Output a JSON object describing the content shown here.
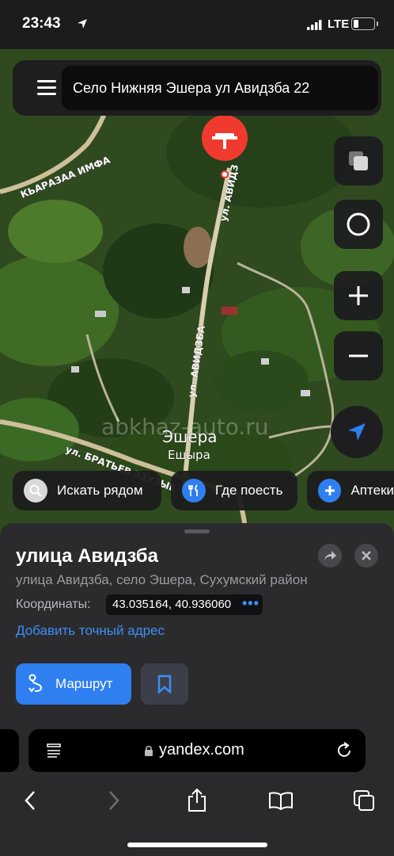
{
  "status_bar": {
    "time": "23:43",
    "network": "LTE"
  },
  "search": {
    "query": "Село Нижняя Эшера ул Авидзба 22"
  },
  "map": {
    "street_labels": [
      "КЬАРАЗАА ИМФА",
      "ул. АВИДЗ",
      "ул. АВИДЗБА",
      "ул. БРАТЬЕВ ЭЗУЗЫЕ"
    ],
    "place_name": "Эшера",
    "place_name_alt": "Ешыра",
    "watermark": "abkhaz-auto.ru"
  },
  "chips": [
    {
      "label": "Искать рядом",
      "icon": "search-icon",
      "color": "#d9d9d9"
    },
    {
      "label": "Где поесть",
      "icon": "fork-knife-icon",
      "color": "#2f7ff0"
    },
    {
      "label": "Аптеки",
      "icon": "plus-icon",
      "color": "#2f7ff0"
    }
  ],
  "card": {
    "title": "улица Авидзба",
    "subtitle": "улица Авидзба, село Эшера, Сухумский район",
    "coords_label": "Координаты:",
    "coords_value": "43.035164, 40.936060",
    "coords_more": "•••",
    "add_address": "Добавить точный адрес",
    "route_label": "Маршрут"
  },
  "browser": {
    "url": "yandex.com"
  },
  "colors": {
    "accent": "#2f7ff0",
    "pin": "#f03a30",
    "card_bg": "#2b2b2e"
  }
}
